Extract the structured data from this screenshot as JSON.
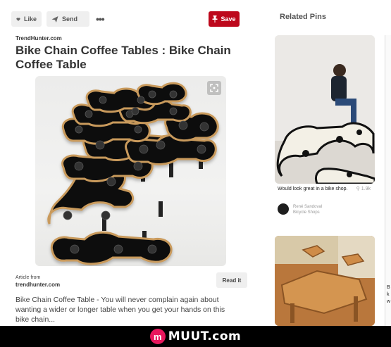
{
  "toolbar": {
    "like_label": "Like",
    "send_label": "Send",
    "more_label": "•••",
    "save_label": "Save"
  },
  "pin": {
    "source_domain": "TrendHunter.com",
    "title": "Bike Chain Coffee Tables : Bike Chain Coffee Table",
    "article_from_label": "Article from",
    "article_domain": "trendhunter.com",
    "read_it_label": "Read it",
    "description": "Bike Chain Coffee Table - You will never complain again about wanting a wider or longer table when you get your hands on this bike chain..."
  },
  "related": {
    "heading": "Related Pins",
    "items": [
      {
        "caption": "Would look great in a bike shop.",
        "saves": "1.9k",
        "user_name": "René Sandoval",
        "board_name": "Bicycle Shops"
      },
      {
        "caption": ""
      }
    ],
    "edge_text": "B\nk\nw"
  },
  "watermark": {
    "mark": "m",
    "text": "MUUT.com"
  },
  "colors": {
    "save_red": "#bd081c",
    "muut_pink": "#e8175d"
  }
}
